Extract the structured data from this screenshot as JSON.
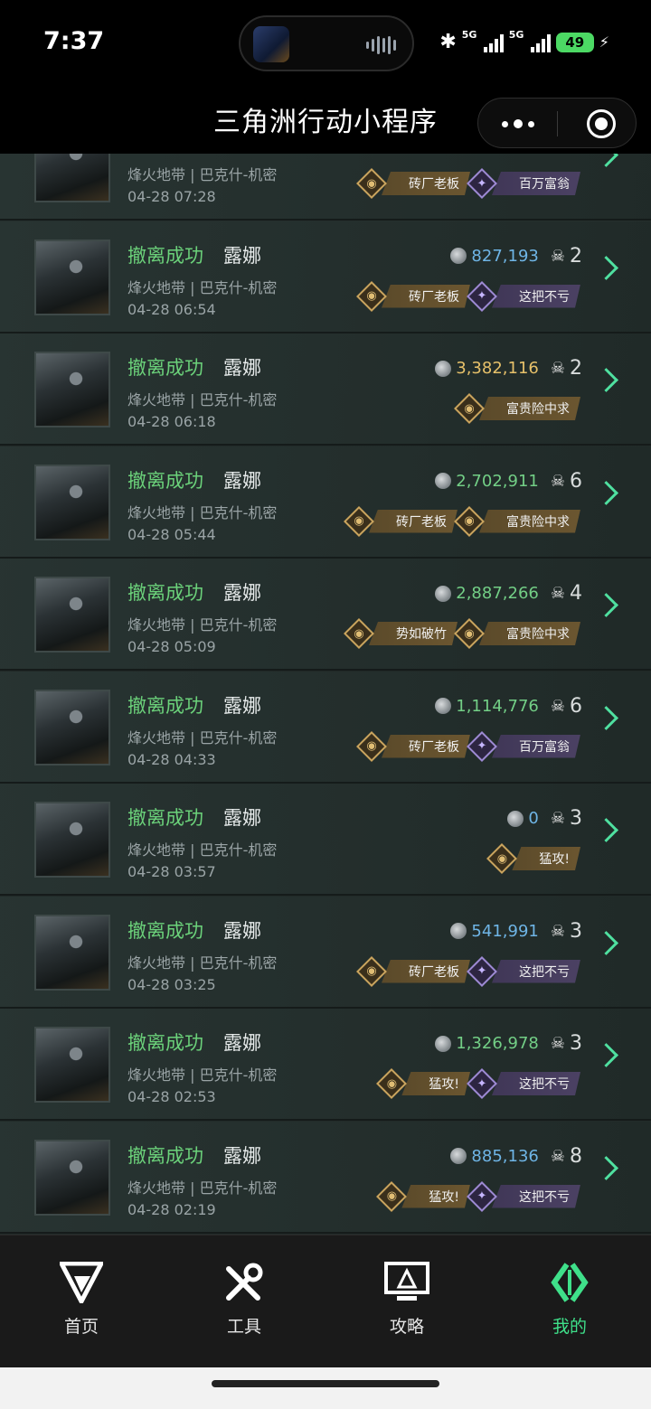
{
  "status_bar": {
    "time": "7:37",
    "network1": "5G",
    "network2": "5G",
    "battery": "49"
  },
  "header": {
    "title": "三角洲行动小程序"
  },
  "records": [
    {
      "status": "",
      "name": "",
      "map": "烽火地带 | 巴克什-机密",
      "time": "04-28 07:28",
      "value": "",
      "kills": "",
      "value_color": "blue",
      "badges": [
        {
          "label": "砖厂老板",
          "type": "gold"
        },
        {
          "label": "百万富翁",
          "type": "purple"
        }
      ]
    },
    {
      "status": "撤离成功",
      "name": "露娜",
      "map": "烽火地带 | 巴克什-机密",
      "time": "04-28 06:54",
      "value": "827,193",
      "kills": "2",
      "value_color": "blue",
      "badges": [
        {
          "label": "砖厂老板",
          "type": "gold"
        },
        {
          "label": "这把不亏",
          "type": "purple"
        }
      ]
    },
    {
      "status": "撤离成功",
      "name": "露娜",
      "map": "烽火地带 | 巴克什-机密",
      "time": "04-28 06:18",
      "value": "3,382,116",
      "kills": "2",
      "value_color": "gold",
      "badges": [
        {
          "label": "富贵险中求",
          "type": "gold"
        }
      ]
    },
    {
      "status": "撤离成功",
      "name": "露娜",
      "map": "烽火地带 | 巴克什-机密",
      "time": "04-28 05:44",
      "value": "2,702,911",
      "kills": "6",
      "value_color": "green",
      "badges": [
        {
          "label": "砖厂老板",
          "type": "gold"
        },
        {
          "label": "富贵险中求",
          "type": "gold"
        }
      ]
    },
    {
      "status": "撤离成功",
      "name": "露娜",
      "map": "烽火地带 | 巴克什-机密",
      "time": "04-28 05:09",
      "value": "2,887,266",
      "kills": "4",
      "value_color": "green",
      "badges": [
        {
          "label": "势如破竹",
          "type": "gold"
        },
        {
          "label": "富贵险中求",
          "type": "gold"
        }
      ]
    },
    {
      "status": "撤离成功",
      "name": "露娜",
      "map": "烽火地带 | 巴克什-机密",
      "time": "04-28 04:33",
      "value": "1,114,776",
      "kills": "6",
      "value_color": "green",
      "badges": [
        {
          "label": "砖厂老板",
          "type": "gold"
        },
        {
          "label": "百万富翁",
          "type": "purple"
        }
      ]
    },
    {
      "status": "撤离成功",
      "name": "露娜",
      "map": "烽火地带 | 巴克什-机密",
      "time": "04-28 03:57",
      "value": "0",
      "kills": "3",
      "value_color": "blue",
      "badges": [
        {
          "label": "猛攻!",
          "type": "gold"
        }
      ]
    },
    {
      "status": "撤离成功",
      "name": "露娜",
      "map": "烽火地带 | 巴克什-机密",
      "time": "04-28 03:25",
      "value": "541,991",
      "kills": "3",
      "value_color": "blue",
      "badges": [
        {
          "label": "砖厂老板",
          "type": "gold"
        },
        {
          "label": "这把不亏",
          "type": "purple"
        }
      ]
    },
    {
      "status": "撤离成功",
      "name": "露娜",
      "map": "烽火地带 | 巴克什-机密",
      "time": "04-28 02:53",
      "value": "1,326,978",
      "kills": "3",
      "value_color": "green",
      "badges": [
        {
          "label": "猛攻!",
          "type": "gold"
        },
        {
          "label": "这把不亏",
          "type": "purple"
        }
      ]
    },
    {
      "status": "撤离成功",
      "name": "露娜",
      "map": "烽火地带 | 巴克什-机密",
      "time": "04-28 02:19",
      "value": "885,136",
      "kills": "8",
      "value_color": "blue",
      "badges": [
        {
          "label": "猛攻!",
          "type": "gold"
        },
        {
          "label": "这把不亏",
          "type": "purple"
        }
      ]
    }
  ],
  "nav": {
    "tabs": [
      {
        "label": "首页",
        "icon": "game-logo-icon"
      },
      {
        "label": "工具",
        "icon": "tools-icon"
      },
      {
        "label": "攻略",
        "icon": "guide-monitor-icon"
      },
      {
        "label": "我的",
        "icon": "profile-logo-icon",
        "active": true
      }
    ]
  },
  "colors": {
    "accent_green": "#3fe08a",
    "status_green": "#6bd17a",
    "value_blue": "#6fb5e6",
    "value_gold": "#e7c16a",
    "value_green": "#73cf86"
  }
}
